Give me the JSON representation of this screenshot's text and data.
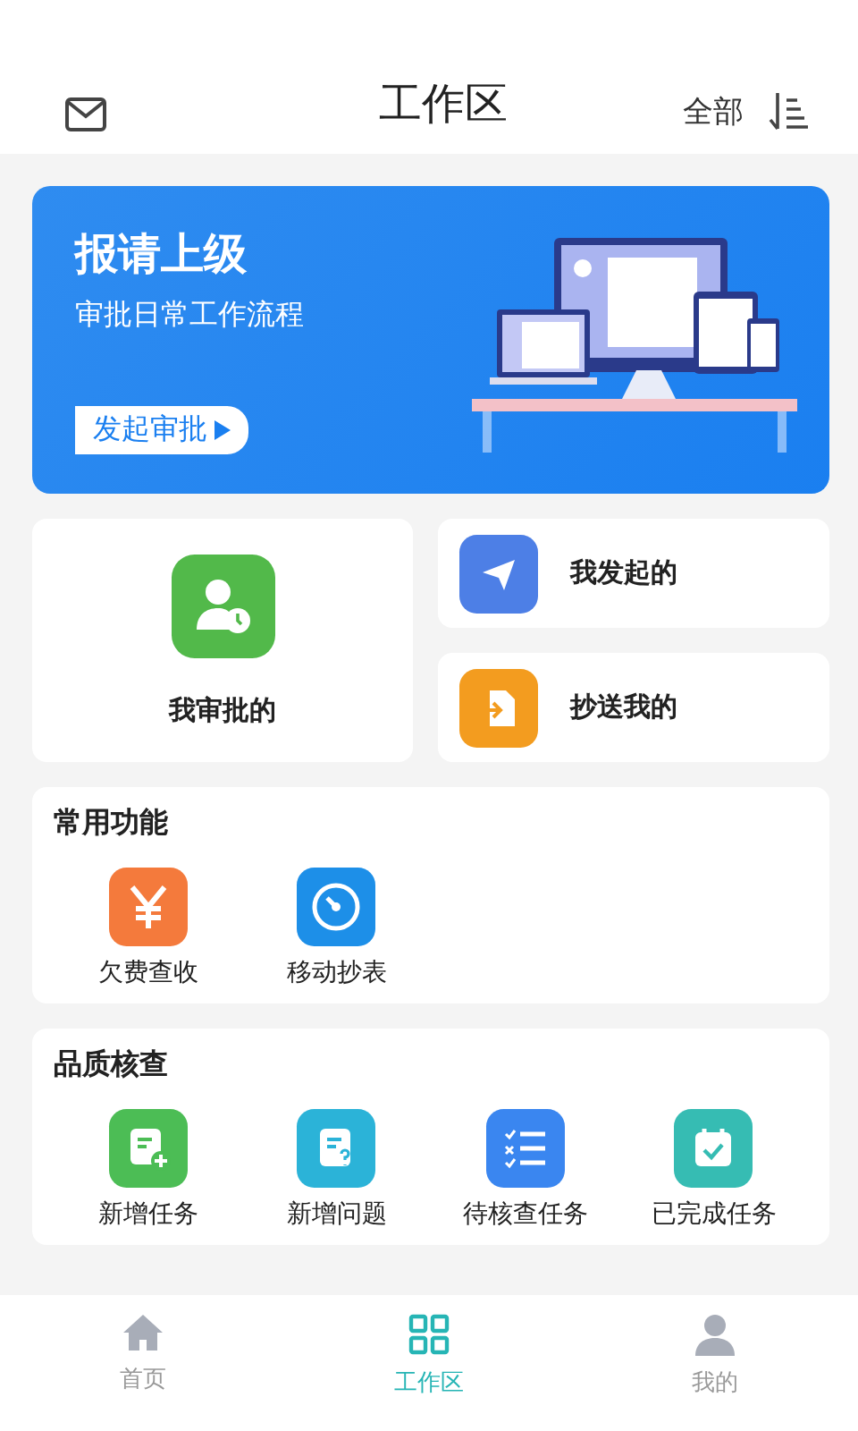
{
  "header": {
    "title": "工作区",
    "filter": "全部"
  },
  "banner": {
    "title": "报请上级",
    "subtitle": "审批日常工作流程",
    "button": "发起审批"
  },
  "approvals": {
    "main": {
      "label": "我审批的"
    },
    "side": [
      {
        "label": "我发起的"
      },
      {
        "label": "抄送我的"
      }
    ]
  },
  "sections": [
    {
      "title": "常用功能",
      "items": [
        {
          "label": "欠费查收"
        },
        {
          "label": "移动抄表"
        }
      ]
    },
    {
      "title": "品质核查",
      "items": [
        {
          "label": "新增任务"
        },
        {
          "label": "新增问题"
        },
        {
          "label": "待核查任务"
        },
        {
          "label": "已完成任务"
        }
      ]
    }
  ],
  "tabs": [
    {
      "label": "首页",
      "selected": false
    },
    {
      "label": "工作区",
      "selected": true
    },
    {
      "label": "我的",
      "selected": false
    }
  ]
}
